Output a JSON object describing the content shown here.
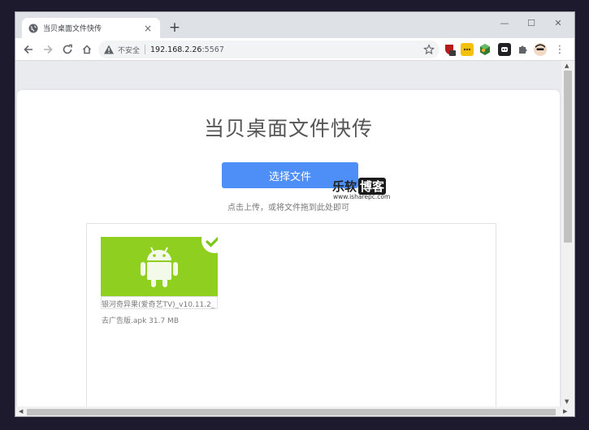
{
  "browser": {
    "tab": {
      "title": "当贝桌面文件快传",
      "close": "×"
    },
    "new_tab": "+",
    "window_controls": {
      "minimize": "—",
      "maximize": "☐",
      "close": "✕"
    },
    "address": {
      "security_label": "不安全",
      "host": "192.168.2.26",
      "port": ":5567"
    },
    "menu": "⋮"
  },
  "page": {
    "title": "当贝桌面文件快传",
    "select_button": "选择文件",
    "hint": "点击上传，或将文件拖到此处即可",
    "files": [
      {
        "name": "银河奇异果(爱奇艺TV)_v10.11.2_去广告版.apk 31.7 MB",
        "status": "uploaded"
      }
    ]
  },
  "watermark": {
    "brand_a": "乐软",
    "brand_b": "博客",
    "url": "www.isharepc.com"
  },
  "colors": {
    "accent": "#4d8ef7",
    "android_green": "#8fcf1f",
    "tab_strip": "#dee1e6"
  },
  "icons": {
    "tab_favicon": "globe-icon",
    "back": "arrow-left-icon",
    "forward": "arrow-right-icon",
    "reload": "reload-icon",
    "home": "home-icon",
    "security": "warning-triangle-icon",
    "bookmark": "star-icon",
    "file_thumb": "android-icon",
    "file_status": "check-icon"
  }
}
